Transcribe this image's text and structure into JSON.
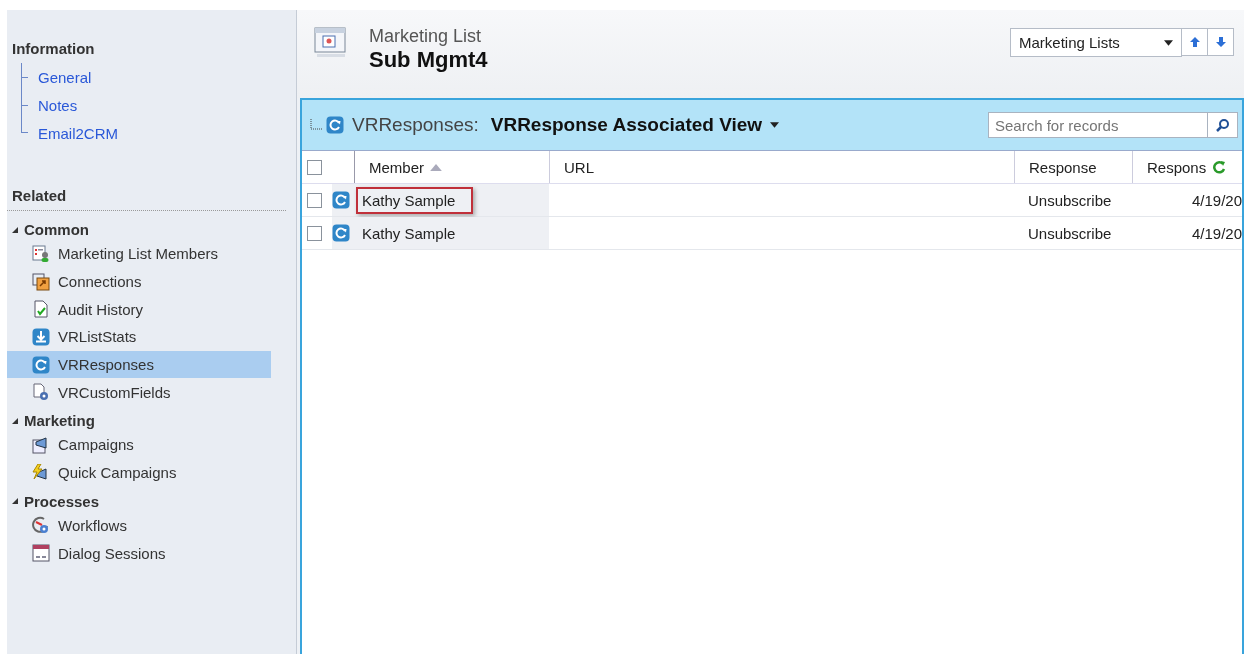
{
  "sidebar": {
    "information": {
      "title": "Information",
      "links": [
        "General",
        "Notes",
        "Email2CRM"
      ]
    },
    "related": {
      "title": "Related",
      "groups": [
        {
          "title": "Common",
          "expanded": true,
          "items": [
            {
              "label": "Marketing List Members",
              "kind": "members",
              "selected": false
            },
            {
              "label": "Connections",
              "kind": "connections",
              "selected": false
            },
            {
              "label": "Audit History",
              "kind": "audit",
              "selected": false
            },
            {
              "label": "VRListStats",
              "kind": "stats",
              "selected": false
            },
            {
              "label": "VRResponses",
              "kind": "responses",
              "selected": true
            },
            {
              "label": "VRCustomFields",
              "kind": "customfields",
              "selected": false
            }
          ]
        },
        {
          "title": "Marketing",
          "expanded": true,
          "items": [
            {
              "label": "Campaigns",
              "kind": "campaign",
              "selected": false
            },
            {
              "label": "Quick Campaigns",
              "kind": "quickcampaign",
              "selected": false
            }
          ]
        },
        {
          "title": "Processes",
          "expanded": true,
          "items": [
            {
              "label": "Workflows",
              "kind": "workflow",
              "selected": false
            },
            {
              "label": "Dialog Sessions",
              "kind": "dialog",
              "selected": false
            }
          ]
        }
      ]
    }
  },
  "header": {
    "entity": "Marketing List",
    "title": "Sub Mgmt4",
    "nav_select": "Marketing Lists"
  },
  "grid": {
    "select_all_checked": false,
    "entity": "VRResponses:",
    "view": "VRResponse Associated View",
    "search": {
      "placeholder": "Search for records"
    },
    "columns": [
      {
        "label": "Member",
        "sorted": true
      },
      {
        "label": "URL",
        "sorted": false
      },
      {
        "label": "Response",
        "sorted": false
      },
      {
        "label": "Respons",
        "sorted": false
      }
    ],
    "rows": [
      {
        "checked": false,
        "highlighted": true,
        "cells": [
          "Kathy Sample",
          "",
          "Unsubscribe",
          "4/19/20"
        ]
      },
      {
        "checked": false,
        "highlighted": false,
        "cells": [
          "Kathy Sample",
          "",
          "Unsubscribe",
          "4/19/20"
        ]
      }
    ]
  }
}
